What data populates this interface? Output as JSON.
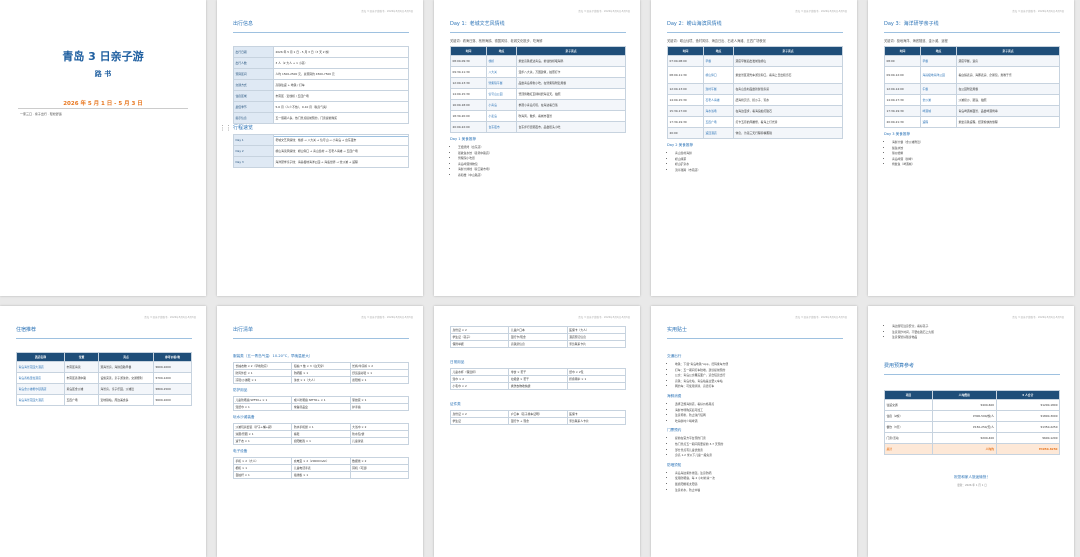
{
  "doc": {
    "running_header": "青岛 3 日亲子游路书 · 2026年5月1日-5月3日",
    "cover": {
      "title": "青岛 3 日亲子游",
      "subtitle": "路 书",
      "date": "2026 年 5 月 1 日 - 5 月 3 日",
      "members": "一家三口 · 亲子出行 · 轻松舒适"
    }
  },
  "pages": {
    "p2": {
      "h_info": "出行信息",
      "info": [
        {
          "k": "出行日期",
          "v": "2026 年 5 月 1 日 - 5 月 3 日（3 天 2 晚）"
        },
        {
          "k": "出行人数",
          "v": "3 人（2 大人 + 1 小孩）"
        },
        {
          "k": "预算区间",
          "v": "人均 1500-2500 元，总预算约 4500-7500 元"
        },
        {
          "k": "交通方式",
          "v": "高铁往返 + 地铁 / 打车"
        },
        {
          "k": "住宿区域",
          "v": "市南区 · 近栈桥 / 五四广场"
        },
        {
          "k": "最佳季节",
          "v": "5-6 月（人少不热），9-10 月（秋高气爽）"
        },
        {
          "k": "提示信息",
          "v": "五一假期人多，热门景点提前预约，门票提前购买"
        }
      ],
      "h_route": "行程速览",
      "route": [
        {
          "d": "Day 1",
          "v": "老城文艺风情线：栈桥 → 八大关 → 信号山 → 小青岛 → 台东夜市"
        },
        {
          "d": "Day 2",
          "v": "崂山海滨风情线：崂山仰口 → 青山渔村 → 石老人海滩 → 五四广场"
        },
        {
          "d": "Day 3",
          "v": "海洋研学亲子线：海昌极地海洋公园 → 海底世界 → 金沙滩 → 返程"
        }
      ]
    },
    "p3": {
      "h": "Day 1：老城文艺风情线",
      "intro": "关键词：看海日落、栈桥海鸥、德国风情、老城文化散步、吃海鲜",
      "cols": [
        "时间",
        "地点",
        "亲子亮点"
      ],
      "rows": [
        [
          "08:00-09:30",
          "栈桥",
          "乘坐高铁抵达青岛，前往栈桥喂海鸥"
        ],
        [
          "09:30-11:30",
          "八大关",
          "漫步八大关，万国建筑，拍照打卡"
        ],
        [
          "12:00-13:30",
          "劈柴院午餐",
          "品尝青岛特色小吃，在劈柴院附近用餐"
        ],
        [
          "14:00-15:30",
          "信号山公园",
          "登顶俯瞰红瓦绿树碧海蓝天，拍照"
        ],
        [
          "16:00-18:00",
          "小青岛",
          "参观小青岛灯塔，在海边看日落"
        ],
        [
          "18:30-20:00",
          "小麦岛",
          "吹海风，散步，看城市夜景"
        ],
        [
          "20:00-22:00",
          "台东夜市",
          "台东步行街逛夜市，品尝街头小吃"
        ]
      ],
      "sub": "Day 1 美食推荐",
      "food": [
        "王姐烧烤（台东店）",
        "船歌鱼水饺（香港中路店）",
        "劈柴院小吃街",
        "青岛啤酒博物馆",
        "海鲜大排档（营口路市场）",
        "春和楼（中山路店）"
      ]
    },
    "p4": {
      "h": "Day 2：崂山海滨风情线",
      "intro": "关键词：崂山仙境、渔村风情、海边日出、石老人海滩、五四广场夜景",
      "cols": [
        "时间",
        "地点",
        "亲子亮点"
      ],
      "rows": [
        [
          "07:00-08:00",
          "早餐",
          "酒店早餐后出发前往崂山"
        ],
        [
          "08:00-11:30",
          "崂山仰口",
          "乘坐景区观光车游览仰口，看海上日出和奇石"
        ],
        [
          "12:00-13:00",
          "渔村午餐",
          "在青山渔村品尝新鲜渔家菜"
        ],
        [
          "14:00-15:30",
          "石老人海滩",
          "赶海捡贝壳、挖沙子、玩水"
        ],
        [
          "15:30-17:00",
          "海水浴场",
          "在海边漫步，看海浪拍打礁石"
        ],
        [
          "17:30-19:30",
          "五四广场",
          "打卡五月的风雕塑，看海上灯光秀"
        ],
        [
          "20:00",
          "返回酒店",
          "休息，为第三天行程养精蓄锐"
        ]
      ],
      "sub": "Day 2 美食推荐",
      "food": [
        "青山渔村海鲜",
        "崂山绿茶",
        "崂山矿泉水",
        "流亭猪蹄（市南店）"
      ]
    },
    "p5": {
      "h": "Day 3：海洋研学亲子线",
      "intro": "关键词：极地海洋、海底隧道、金沙滩、返程",
      "cols": [
        "时间",
        "地点",
        "亲子亮点"
      ],
      "rows": [
        [
          "08:00",
          "早餐",
          "酒店早餐，退房"
        ],
        [
          "09:00-12:00",
          "海昌极地海洋公园",
          "看白鲸表演、海豚表演、企鹅馆，寓教于乐"
        ],
        [
          "12:00-14:00",
          "午餐",
          "在公园附近用餐"
        ],
        [
          "14:00-17:30",
          "金沙滩",
          "沙滩挖沙、踏浪、拍照"
        ],
        [
          "17:30-19:30",
          "啤酒城",
          "青岛啤酒城夜景、品尝啤酒烤串"
        ],
        [
          "20:00-21:30",
          "返程",
          "乘坐高铁返程，结束愉快的旅程"
        ]
      ],
      "sub": "Day 3 美食推荐",
      "food": [
        "海鲜大餐（金沙滩附近）",
        "鲅鱼水饺",
        "辣炒蛤蜊",
        "青岛啤酒（鲜啤）",
        "烤鱿鱼（啤酒城）"
      ]
    },
    "p6": {
      "h": "住宿推荐",
      "cols": [
        "酒店名称",
        "位置",
        "亮点",
        "参考价格/晚"
      ],
      "rows": [
        [
          "青岛海景花园大酒店",
          "市南区海滨",
          "观海景房，海鲜自助早餐",
          "¥600-1000"
        ],
        [
          "青岛香格里拉酒店",
          "市南区香港中路",
          "设施完善，亲子游泳池，交通便利",
          "¥700-1200"
        ],
        [
          "青岛金沙滩希尔顿酒店",
          "黄岛区金沙滩",
          "海景房，亲子乐园，沙滩近",
          "¥800-1500"
        ],
        [
          "青岛海景花园大酒店",
          "五四广场",
          "近地铁站，周边美食多",
          "¥600-1000"
        ]
      ]
    },
    "p7": {
      "h": "出行清单",
      "sub1": "服装类（五一青岛气温：10-20°C，早晚温差大）",
      "g1": [
        [
          "长袖衣物 × 2（早晚较凉）",
          "短袖 T 恤 × 3（白天穿）",
          "长裤/牛仔裤 × 2"
        ],
        [
          "防风外套 × 1",
          "防晒服 × 1",
          "舒适运动鞋 × 1"
        ],
        [
          "凉鞋/沙滩鞋 × 1",
          "泳衣 × 1（大人）",
          "遮阳帽 × 1"
        ]
      ],
      "sub2": "防护用品",
      "g2": [
        [
          "儿童防晒霜 SPF50+ × 1",
          "成人防晒霜 SPF30+ × 1",
          "驱蚊液 × 1"
        ],
        [
          "湿纸巾 × 1",
          "常备药品盒",
          "护手霜"
        ]
      ],
      "sub3": "玩水沙滩装备",
      "g3": [
        [
          "沙滩玩具套装（铲子+桶+耙）",
          "防水手机袋 × 1",
          "大浴巾 × 2"
        ],
        [
          "泳圈/臂圈 × 1",
          "拖鞋",
          "防水包/袋"
        ],
        [
          "速干衣 × 1",
          "遮阳帐篷 × 1",
          "儿童泳镜"
        ]
      ],
      "sub4": "电子设备",
      "g4": [
        [
          "手机 × 2（大人）",
          "充电宝 × 2（20000mAh）",
          "数据线 × 2"
        ],
        [
          "相机 × 1",
          "儿童电话手表",
          "耳机（可选）"
        ],
        [
          "自拍杆 × 1",
          "插线板 × 1"
        ]
      ]
    },
    "p8": {
      "g0": [
        [
          "身份证 × 2",
          "儿童户口本",
          "医保卡（大人）"
        ],
        [
          "学生证（孩子）",
          "银行卡/现金",
          "酒店预订信息"
        ],
        [
          "保险单据",
          "高铁票信息",
          "紧急联系卡片"
        ]
      ],
      "sub1": "日常用品",
      "g1": [
        [
          "儿童水杯（保温杯）",
          "零食 × 若干",
          "纸巾 × 2包"
        ],
        [
          "湿巾 × 2",
          "垃圾袋 × 若干",
          "折叠雨伞 × 1"
        ],
        [
          "小毛巾 × 2",
          "换洗衣物收纳袋"
        ]
      ],
      "sub2": "证件类",
      "g2": [
        [
          "身份证 × 2",
          "户口本（孩子乘车证明）",
          "医保卡"
        ],
        [
          "学生证",
          "银行卡 + 现金",
          "紧急联系人卡片"
        ]
      ]
    },
    "p9": {
      "h": "实用贴士",
      "sub1": "交通出行",
      "t1": [
        "地铁：下载“青岛地铁”App，扫码乘车方便",
        "打车：五一期间打车较难，建议提前预约",
        "公交：青岛公交覆盖面广，适合短途出行",
        "高铁：青岛北站、青岛站是主要火车站",
        "网约车：可使用滴滴、高德打车"
      ],
      "sub2": "海鲜消费",
      "t2": [
        "选择正规海鲜店，看好价格再点",
        "海鲜市场购买后可加工",
        "注意称重，防止缺斤短两",
        "吃海鲜时少喝啤酒"
      ],
      "sub3": "门票预约",
      "t3": [
        "提前在官方平台预约门票",
        "热门景点五一期间需要提前 3-7 天预约",
        "部分景点有儿童优惠票",
        "身高 1.2 米以下儿童一般免票"
      ],
      "sub4": "防晒须知",
      "t4": [
        "青岛海边紫外线强，注意防晒",
        "使用防晒霜，每 2 小时补涂一次",
        "戴遮阳帽和太阳镜",
        "注意补水，防止中暑"
      ]
    },
    "p10": {
      "top": [
        "海边游玩注意安全，看好孩子",
        "注意潮汐时间，不要在礁石上久留",
        "注意保管好随身物品"
      ],
      "h": "费用预算参考",
      "cols": [
        "项目",
        "人均费用",
        "3 人合计"
      ],
      "rows": [
        [
          "往返交通",
          "¥400-600",
          "¥1200-1800"
        ],
        [
          "住宿（2晚）",
          "¥300-500/晚/人",
          "¥1800-3000"
        ],
        [
          "餐饮（3天）",
          "¥150-250/天/人",
          "¥1350-2250"
        ],
        [
          "门票/活动",
          "¥200-400",
          "¥600-1200"
        ]
      ],
      "total": [
        "总计",
        "人均约",
        "¥4950-8250"
      ],
      "closing": "祝您和家人旅途愉快！",
      "closing2": "更新：2026 年 1 月 1 日"
    }
  }
}
